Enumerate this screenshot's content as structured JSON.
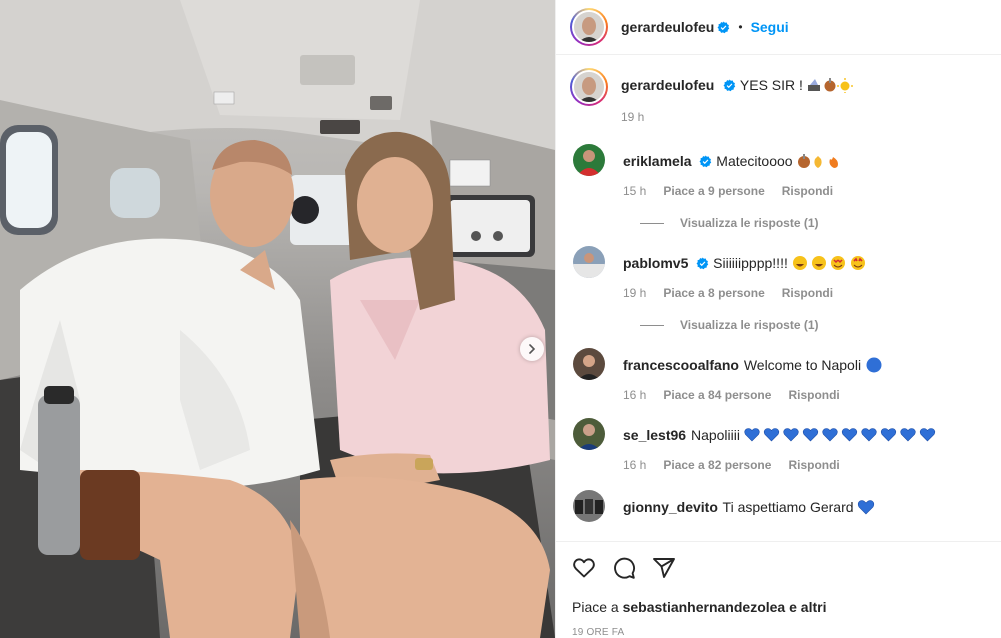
{
  "post": {
    "author": "gerardeulofeu",
    "follow_label": "Segui",
    "dot": "•",
    "caption_text": "YES SIR !",
    "caption_time": "19 h"
  },
  "comments": [
    {
      "user": "eriklamela",
      "verified": true,
      "text": "Matecitoooo",
      "time": "15 h",
      "likes": "Piace a 9 persone",
      "reply": "Rispondi",
      "view_replies": "Visualizza le risposte (1)"
    },
    {
      "user": "pablomv5",
      "verified": true,
      "text": "Siiiiiipppp!!!!",
      "time": "19 h",
      "likes": "Piace a 8 persone",
      "reply": "Rispondi",
      "view_replies": "Visualizza le risposte (1)"
    },
    {
      "user": "francescooalfano",
      "verified": false,
      "text": "Welcome to Napoli",
      "time": "16 h",
      "likes": "Piace a 84 persone",
      "reply": "Rispondi"
    },
    {
      "user": "se_lest96",
      "verified": false,
      "text": "Napoliiii",
      "time": "16 h",
      "likes": "Piace a 82 persone",
      "reply": "Rispondi"
    },
    {
      "user": "gionny_devito",
      "verified": false,
      "text": "Ti aspettiamo Gerard"
    }
  ],
  "footer": {
    "likes_prefix": "Piace a",
    "likes_user": "sebastianhernandezolea",
    "likes_suffix": "e altri",
    "time_ago": "19 ORE FA"
  },
  "colors": {
    "accent": "#0095f6",
    "verified": "#0095f6",
    "muted": "#8e8e8e",
    "heart_blue": "#2f6fd6"
  },
  "icons": [
    "heart-icon",
    "comment-icon",
    "share-icon",
    "verified-icon",
    "chevron-right-icon"
  ]
}
